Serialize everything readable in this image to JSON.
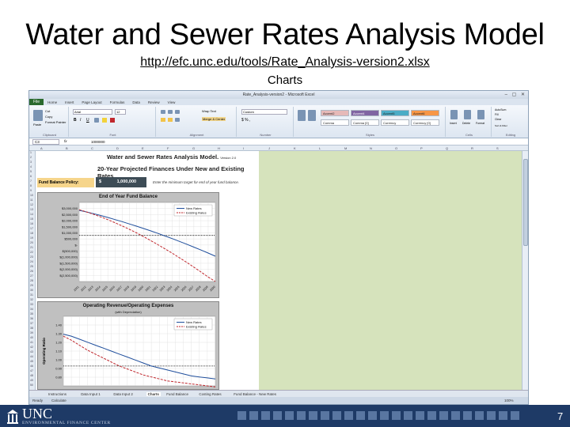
{
  "slide": {
    "title": "Water and Sewer Rates Analysis Model",
    "link": "http://efc.unc.edu/tools/Rate_Analysis-version2.xlsx",
    "subtitle": "Charts",
    "page_number": "7"
  },
  "excel": {
    "window_title": "Rate_Analysis-version2 - Microsoft Excel",
    "ribbon_tabs": [
      "File",
      "Home",
      "Insert",
      "Page Layout",
      "Formulas",
      "Data",
      "Review",
      "View"
    ],
    "ribbon_groups": [
      "Clipboard",
      "Font",
      "Alignment",
      "Number",
      "Styles",
      "Cells",
      "Editing"
    ],
    "clipboard": {
      "cut": "Cut",
      "copy": "Copy",
      "format_painter": "Format Painter",
      "paste": "Paste"
    },
    "font_name": "Arial",
    "font_size": "12",
    "wrap_text": "Wrap Text",
    "merge_center": "Merge & Center",
    "number_format": "Custom",
    "styles": [
      {
        "label": "Accent2",
        "color": "#e6b9b8"
      },
      {
        "label": "Accent4",
        "color": "#8064a2"
      },
      {
        "label": "Accent5",
        "color": "#4bacc6"
      },
      {
        "label": "Accent6",
        "color": "#f79646"
      },
      {
        "label": "Comma",
        "color": "#ffffff"
      },
      {
        "label": "Comma [0]",
        "color": "#ffffff"
      },
      {
        "label": "Currency",
        "color": "#ffffff"
      },
      {
        "label": "Currency [0]",
        "color": "#ffffff"
      }
    ],
    "cells_buttons": [
      "Insert",
      "Delete",
      "Format"
    ],
    "editing": {
      "autosum": "AutoSum",
      "fill": "Fill",
      "clear": "Clear",
      "sort": "Sort & Filter",
      "find": "Find & Select"
    },
    "name_box": "C3",
    "formula_value": "1000000",
    "columns": [
      "A",
      "B",
      "C",
      "D",
      "E",
      "F",
      "G",
      "H",
      "I",
      "J",
      "K",
      "L",
      "M",
      "N",
      "O",
      "P",
      "Q",
      "R",
      "S"
    ],
    "sheet": {
      "model_title": "Water and Sewer Rates Analysis Model.",
      "version": "Version 2.0",
      "projection_title": "20-Year Projected Finances Under New and Existing Rates",
      "policy_label": "Fund Balance Policy:",
      "policy_currency": "$",
      "policy_value": "1,000,000",
      "policy_note": "Enter the minimum target for end of year fund balance."
    },
    "sheet_tabs": [
      "Instructions",
      "Data Input 1",
      "Data Input 2",
      "Charts",
      "Fund Balance",
      "Costing Rates",
      "Fund Balance - New Rates"
    ],
    "active_sheet": "Charts",
    "status": {
      "ready": "Ready",
      "calculate": "Calculate",
      "zoom": "100%"
    }
  },
  "chart_data": [
    {
      "type": "line",
      "title": "End of Year Fund Balance",
      "x": [
        "2011",
        "2012",
        "2013",
        "2014",
        "2015",
        "2016",
        "2017",
        "2018",
        "2019",
        "2020",
        "2021",
        "2022",
        "2023",
        "2024",
        "2025",
        "2026",
        "2027",
        "2028",
        "2029",
        "2030"
      ],
      "series": [
        {
          "name": "New Rates",
          "color": "#1f4e9c",
          "dash": "none",
          "values": [
            2900000,
            2780000,
            2650000,
            2510000,
            2360000,
            2200000,
            2040000,
            1870000,
            1700000,
            1520000,
            1340000,
            1150000,
            950000,
            750000,
            540000,
            330000,
            110000,
            -110000,
            -340000,
            -580000
          ]
        },
        {
          "name": "Existing Rates",
          "color": "#c0272d",
          "dash": "dashed",
          "values": [
            2950000,
            2780000,
            2600000,
            2400000,
            2190000,
            1960000,
            1720000,
            1460000,
            1190000,
            900000,
            600000,
            290000,
            -30000,
            -360000,
            -700000,
            -1050000,
            -1410000,
            -1780000,
            -2160000,
            -2500000
          ]
        }
      ],
      "threshold": 1000000,
      "ylim": [
        -2500000,
        3500000
      ],
      "ytick_labels": [
        "$3,000,000",
        "$2,500,000",
        "$2,000,000",
        "$1,500,000",
        "$1,000,000",
        "$500,000",
        "$-",
        "$(500,000)",
        "$(1,000,000)",
        "$(1,500,000)",
        "$(2,000,000)",
        "$(2,500,000)"
      ],
      "legend": "top-right",
      "grid": true
    },
    {
      "type": "line",
      "title": "Operating Revenue/Operating Expenses",
      "subtitle": "(with Depreciation)",
      "ylabel": "Operating Ratio",
      "series": [
        {
          "name": "New Rates",
          "color": "#1f4e9c",
          "dash": "none",
          "values": [
            1.32,
            1.3,
            1.27,
            1.24,
            1.21,
            1.18,
            1.15,
            1.12,
            1.09,
            1.06,
            1.03,
            1.0,
            0.98,
            0.96,
            0.94,
            0.92,
            0.9,
            0.89,
            0.88,
            0.87
          ]
        },
        {
          "name": "Existing Rates",
          "color": "#c0272d",
          "dash": "dashed",
          "values": [
            1.3,
            1.26,
            1.21,
            1.16,
            1.12,
            1.08,
            1.04,
            1.0,
            0.97,
            0.94,
            0.91,
            0.89,
            0.87,
            0.85,
            0.84,
            0.83,
            0.82,
            0.81,
            0.8,
            0.79
          ]
        }
      ],
      "threshold": 1.0,
      "ylim": [
        0.8,
        1.5
      ],
      "ytick_labels": [
        "1.40",
        "1.30",
        "1.20",
        "1.10",
        "1.00",
        "0.90",
        "0.80"
      ],
      "legend": "top-right",
      "grid": true
    }
  ]
}
